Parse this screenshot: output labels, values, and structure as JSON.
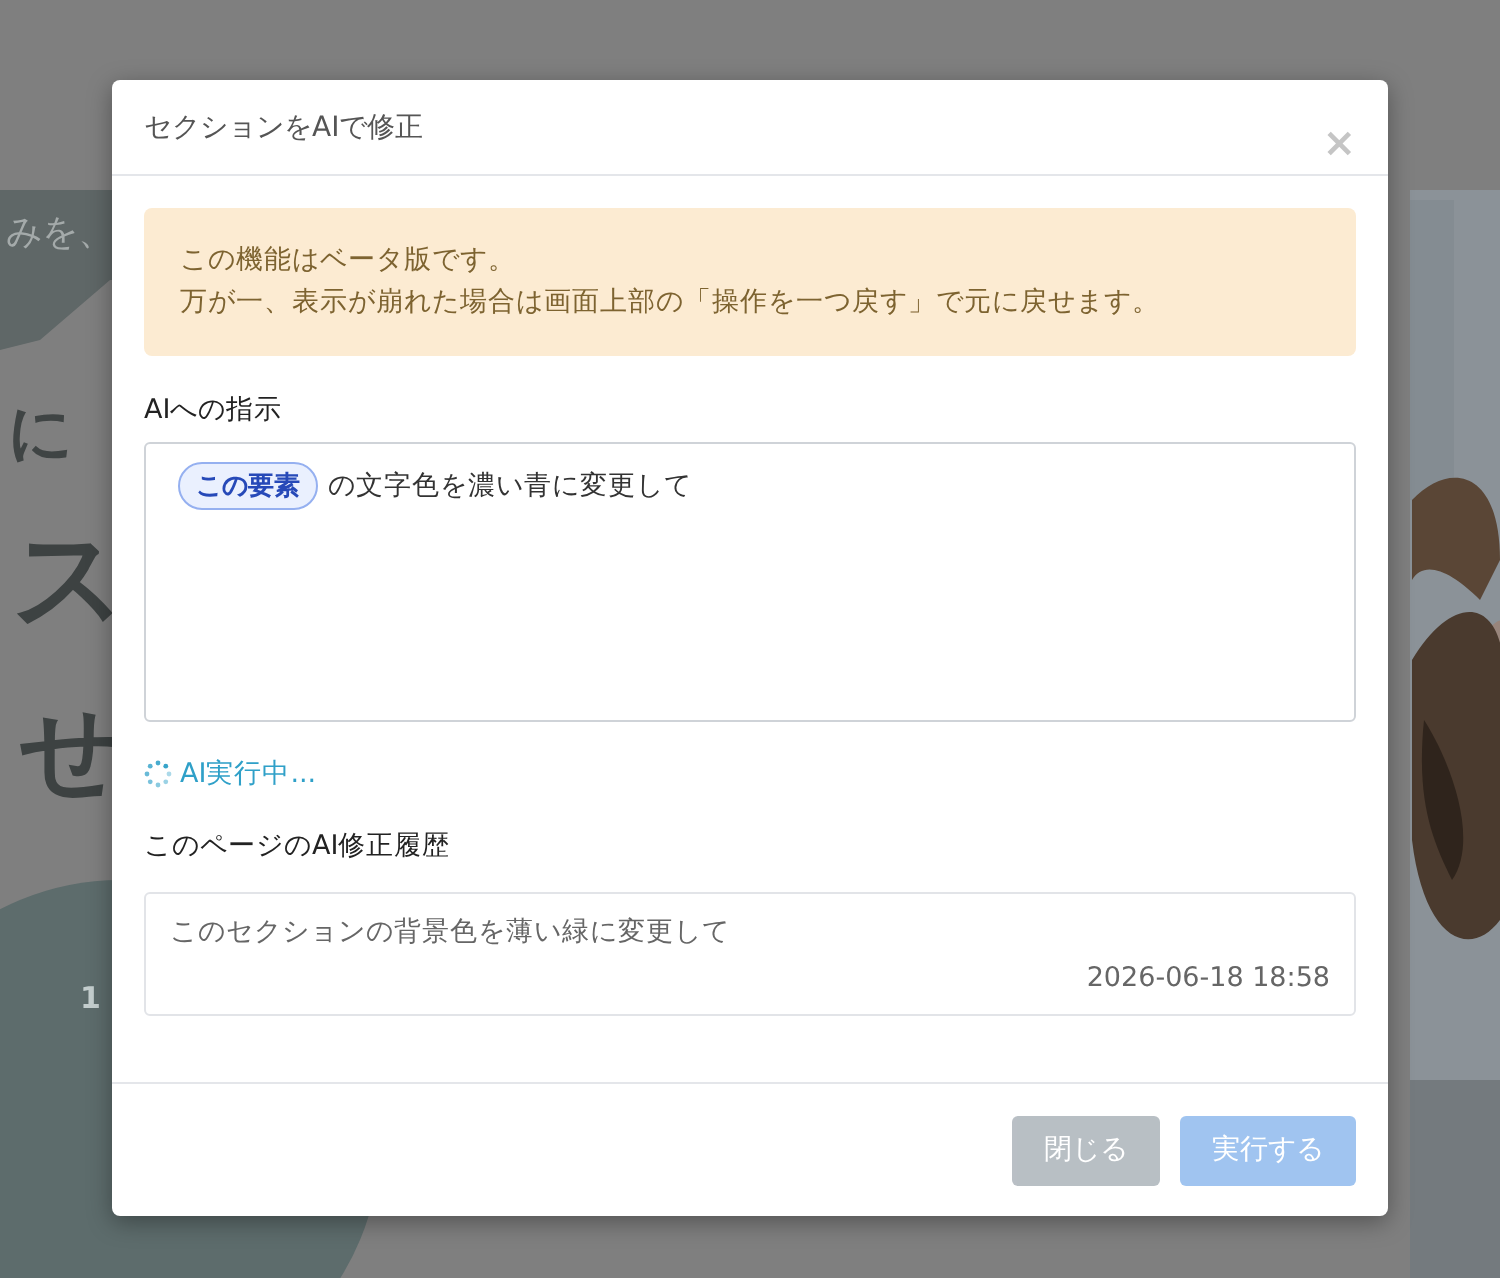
{
  "background_page": {
    "texts": [
      {
        "kind": "ribbon",
        "text": "みを、"
      },
      {
        "kind": "heading-small",
        "text": "に"
      },
      {
        "kind": "heading-large",
        "text": "ス"
      },
      {
        "kind": "heading-medium",
        "text": "せ"
      },
      {
        "kind": "circle-label",
        "text": "1"
      }
    ]
  },
  "dialog": {
    "title": "セクションをAIで修正",
    "close": "×",
    "alert": [
      "この機能はベータ版です。",
      "万が一、表示が崩れた場合は画面上部の「操作を一つ戻す」で元に戻せます。"
    ],
    "instruction": {
      "label": "AIへの指示",
      "chip": "この要素",
      "value": "の文字色を濃い青に変更して"
    },
    "status": {
      "text": "AI実行中...",
      "running": true
    },
    "history": {
      "label": "このページのAI修正履歴",
      "items": [
        {
          "text": "このセクションの背景色を薄い緑に変更して",
          "time": "2026-06-18 18:58"
        }
      ]
    },
    "buttons": [
      {
        "label": "閉じる",
        "kind": "secondary",
        "disabled": true
      },
      {
        "label": "実行する",
        "kind": "primary",
        "disabled": true
      }
    ]
  }
}
